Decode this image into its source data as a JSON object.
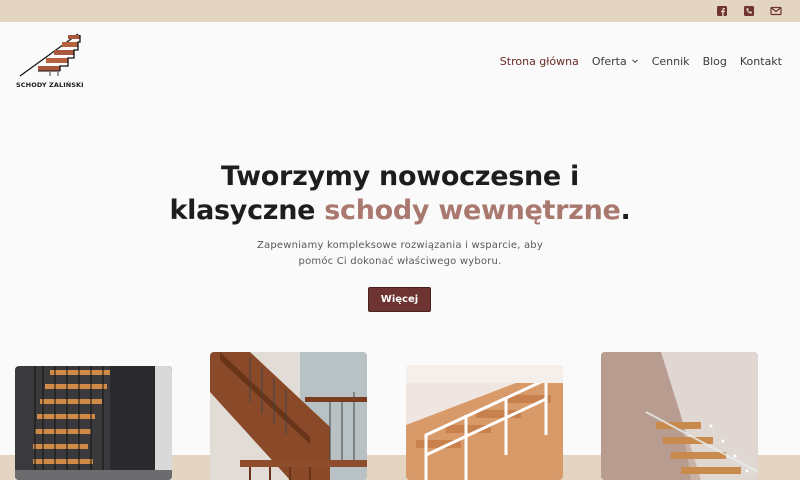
{
  "topbar": {
    "icons": [
      {
        "name": "facebook-icon"
      },
      {
        "name": "phone-icon"
      },
      {
        "name": "mail-icon"
      }
    ]
  },
  "logo": {
    "text": "SCHODY ZALIŃSKI"
  },
  "nav": {
    "items": [
      {
        "label": "Strona główna",
        "active": true
      },
      {
        "label": "Oferta",
        "has_dropdown": true
      },
      {
        "label": "Cennik"
      },
      {
        "label": "Blog"
      },
      {
        "label": "Kontakt"
      }
    ]
  },
  "hero": {
    "title_line1": "Tworzymy nowoczesne i",
    "title_line2_start": "klasyczne ",
    "title_accent": "schody wewnętrzne",
    "title_end": ".",
    "subtitle_line1": "Zapewniamy kompleksowe rozwiązania i wsparcie, aby",
    "subtitle_line2": "pomóc Ci dokonać właściwego wyboru.",
    "cta_label": "Więcej"
  },
  "colors": {
    "accent": "#a9786f",
    "button": "#6d3431",
    "active_nav": "#6b2a25",
    "band": "#e4d5c3"
  },
  "gallery": [
    {
      "name": "stairs-photo-dark"
    },
    {
      "name": "stairs-photo-wooden-railing"
    },
    {
      "name": "stairs-photo-white-railing"
    },
    {
      "name": "stairs-photo-glass"
    }
  ]
}
